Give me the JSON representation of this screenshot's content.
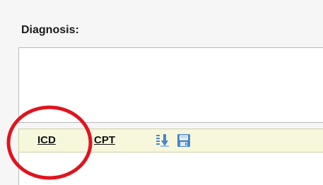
{
  "form": {
    "diagnosis_label": "Diagnosis:",
    "diagnosis_value": ""
  },
  "toolbar": {
    "icd_label": "ICD",
    "cpt_label": "CPT",
    "insert_icon": "insert-list-icon",
    "save_icon": "save-disk-icon"
  },
  "annotation": {
    "ring_color": "#e0141e"
  },
  "colors": {
    "toolbar_bg": "#f7f7dc",
    "icon_blue": "#4a86c8"
  }
}
